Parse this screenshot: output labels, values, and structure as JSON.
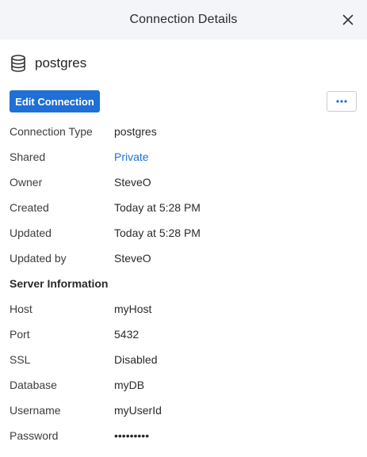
{
  "header": {
    "title": "Connection Details"
  },
  "connection": {
    "name": "postgres"
  },
  "actions": {
    "edit_label": "Edit Connection",
    "more_label": "•••"
  },
  "details": [
    {
      "label": "Connection Type",
      "value": "postgres"
    },
    {
      "label": "Shared",
      "value": "Private"
    },
    {
      "label": "Owner",
      "value": "SteveO"
    },
    {
      "label": "Created",
      "value": "Today at 5:28 PM"
    },
    {
      "label": "Updated",
      "value": "Today at 5:28 PM"
    },
    {
      "label": "Updated by",
      "value": "SteveO"
    }
  ],
  "server": {
    "section_title": "Server Information",
    "rows": [
      {
        "label": "Host",
        "value": "myHost"
      },
      {
        "label": "Port",
        "value": "5432"
      },
      {
        "label": "SSL",
        "value": "Disabled"
      },
      {
        "label": "Database",
        "value": "myDB"
      },
      {
        "label": "Username",
        "value": "myUserId"
      },
      {
        "label": "Password",
        "value": "•••••••••"
      }
    ]
  },
  "colors": {
    "accent": "#1f6fd6",
    "header_bg": "#f3f5f9"
  },
  "icons": {
    "close": "close-icon",
    "database": "database-icon",
    "more": "more-horizontal-icon"
  }
}
